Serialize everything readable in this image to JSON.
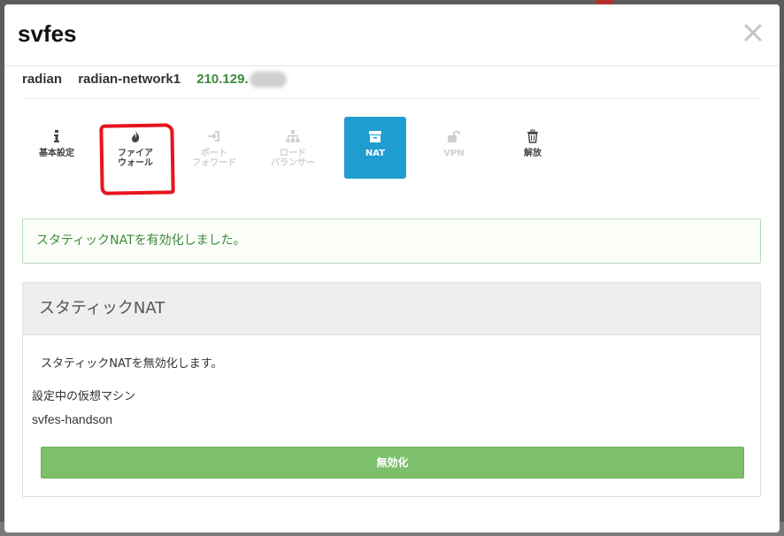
{
  "modal": {
    "title": "svfes",
    "close_icon": "close-icon"
  },
  "info": {
    "name": "radian",
    "network": "radian-network1",
    "ip": "210.129."
  },
  "tabs": [
    {
      "label": "基本設定",
      "icon": "info-icon",
      "state": "normal"
    },
    {
      "label": "ファイア\nウォール",
      "icon": "fire-icon",
      "state": "normal"
    },
    {
      "label": "ポート\nフォワード",
      "icon": "sign-in-icon",
      "state": "disabled"
    },
    {
      "label": "ロード\nバランサー",
      "icon": "sitemap-icon",
      "state": "disabled"
    },
    {
      "label": "NAT",
      "icon": "archive-icon",
      "state": "active"
    },
    {
      "label": "VPN",
      "icon": "unlock-icon",
      "state": "disabled"
    },
    {
      "label": "解放",
      "icon": "trash-icon",
      "state": "normal"
    }
  ],
  "alert": {
    "message": "スタティックNATを有効化しました。"
  },
  "panel": {
    "heading": "スタティックNAT",
    "description": "スタティックNATを無効化します。",
    "vm_label": "設定中の仮想マシン",
    "vm_name": "svfes-handson",
    "disable_button": "無効化"
  },
  "colors": {
    "accent_active": "#1f9cd0",
    "success_text": "#3c8a3c",
    "button_green": "#7dc06c",
    "annotation_red": "#e8141e"
  }
}
